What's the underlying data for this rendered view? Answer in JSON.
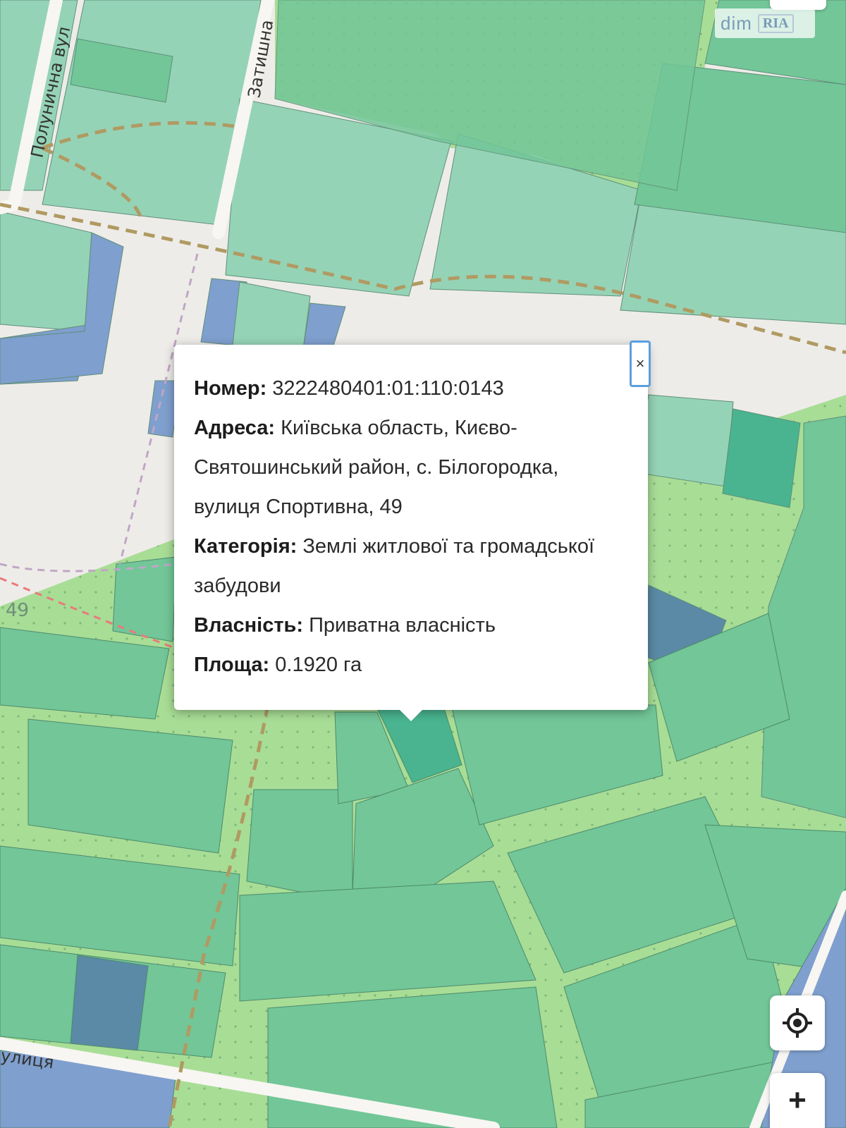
{
  "map": {
    "street_labels": {
      "polunychna": "Полунична вул",
      "zatyshna": "Затишна",
      "bottom_street": "улиця",
      "house_number": "49"
    }
  },
  "popup": {
    "rows": [
      {
        "label": "Номер:",
        "value": "3222480401:01:110:0143"
      },
      {
        "label": "Адреса:",
        "value": "Київська область, Києво-Святошинський район, с. Білогородка, вулиця Спортивна, 49"
      },
      {
        "label": "Категорія:",
        "value": "Землі житлової та громадської забудови"
      },
      {
        "label": "Власність:",
        "value": "Приватна власність"
      },
      {
        "label": "Площа:",
        "value": "0.1920 га"
      }
    ],
    "close_symbol": "×"
  },
  "watermark": {
    "dim": "dim",
    "ria": "RIA"
  },
  "controls": {
    "locate_icon": "crosshair-icon",
    "zoom_in_symbol": "+"
  },
  "colors": {
    "parcel_light": "#95d3b6",
    "parcel_green": "#72c698",
    "parcel_selected": "#49b48f",
    "parcel_blue": "#7f9fce",
    "greenspace": "#a8dd96",
    "road": "#eeece8",
    "path": "#b09a62"
  }
}
